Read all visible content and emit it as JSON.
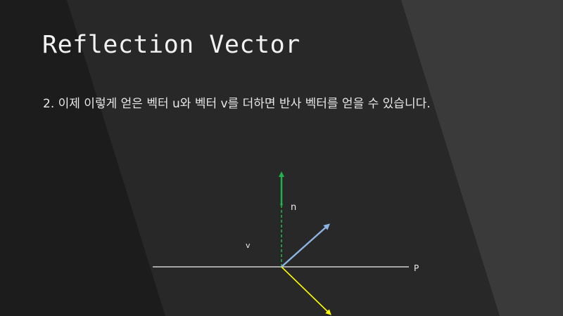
{
  "slide": {
    "title": "Reflection Vector",
    "body_text": "2. 이제 이렇게 얻은 벡터 u와 벡터 v를 더하면 반사 벡터를 얻을 수 있습니다."
  },
  "diagram": {
    "labels": {
      "normal": "n",
      "v": "v",
      "plane": "P"
    },
    "colors": {
      "background": "#2a2a2a",
      "stripe_dark": "#1c1c1c",
      "stripe_light": "#3a3a3a",
      "plane": "#f2f2f2",
      "normal": "#22b14c",
      "reflected": "#8eb4e3",
      "incoming": "#ffff00"
    }
  }
}
